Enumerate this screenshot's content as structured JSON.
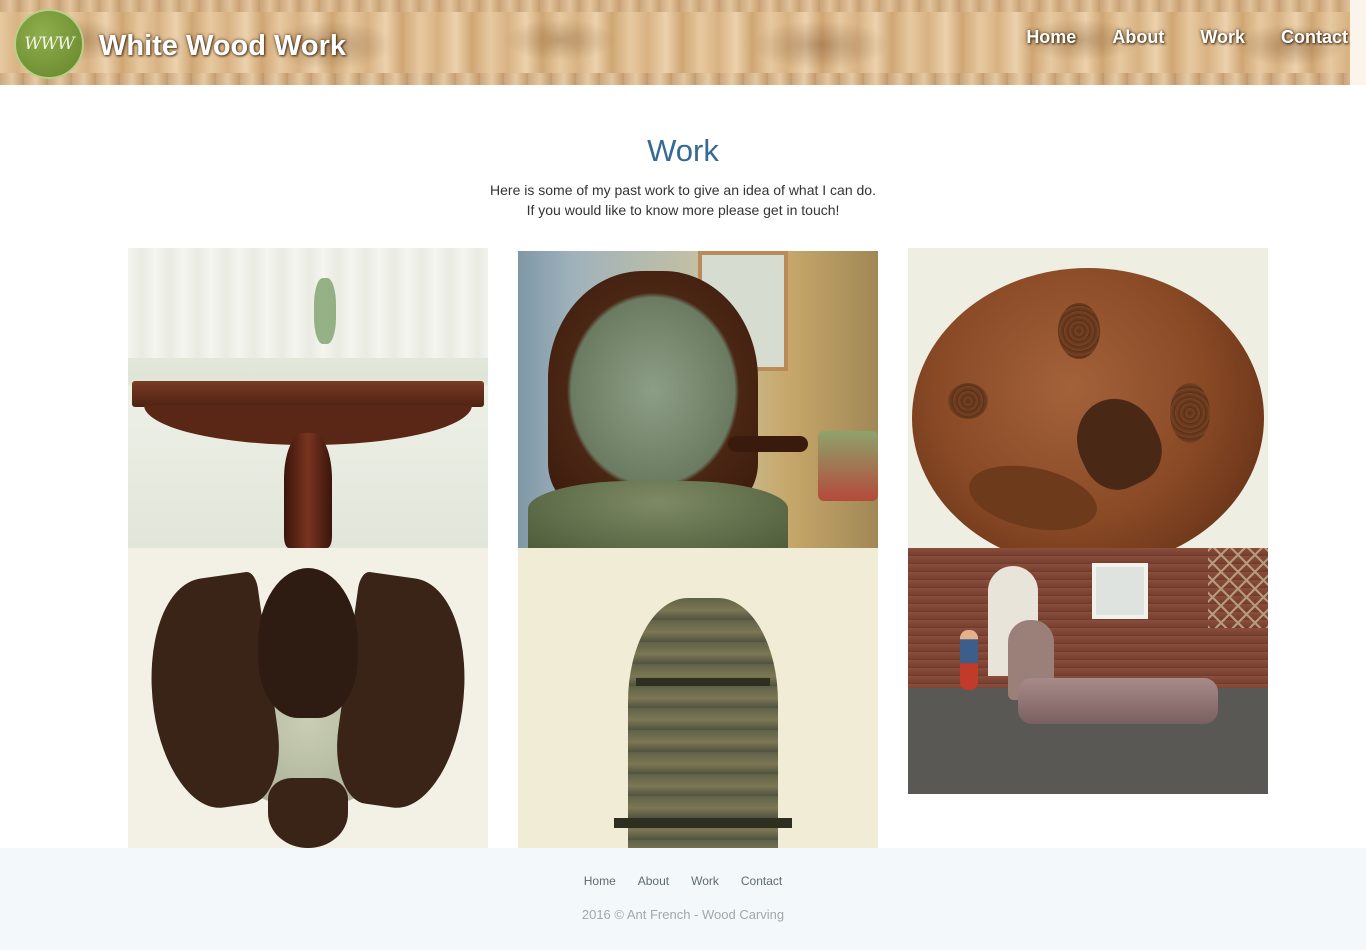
{
  "header": {
    "logo_text": "WWW",
    "site_title": "White Wood Work",
    "nav": [
      {
        "label": "Home"
      },
      {
        "label": "About"
      },
      {
        "label": "Work"
      },
      {
        "label": "Contact"
      }
    ]
  },
  "main": {
    "title": "Work",
    "intro_line1": "Here is some of my past work to give an idea of what I can do.",
    "intro_line2": "If you would like to know more please get in touch!",
    "gallery": [
      {
        "icon": "carved-table-photo"
      },
      {
        "icon": "carved-chair-photo"
      },
      {
        "icon": "squirrel-plaque-photo"
      },
      {
        "icon": "eagle-mirror-photo"
      },
      {
        "icon": "carved-shelf-photo"
      },
      {
        "icon": "chaise-longue-photo"
      }
    ]
  },
  "footer": {
    "nav": [
      {
        "label": "Home"
      },
      {
        "label": "About"
      },
      {
        "label": "Work"
      },
      {
        "label": "Contact"
      }
    ],
    "copyright": "2016 © Ant French - Wood Carving"
  },
  "colors": {
    "title": "#366a94",
    "logo_green": "#7a9a3c",
    "footer_bg": "#f3f8fb"
  }
}
